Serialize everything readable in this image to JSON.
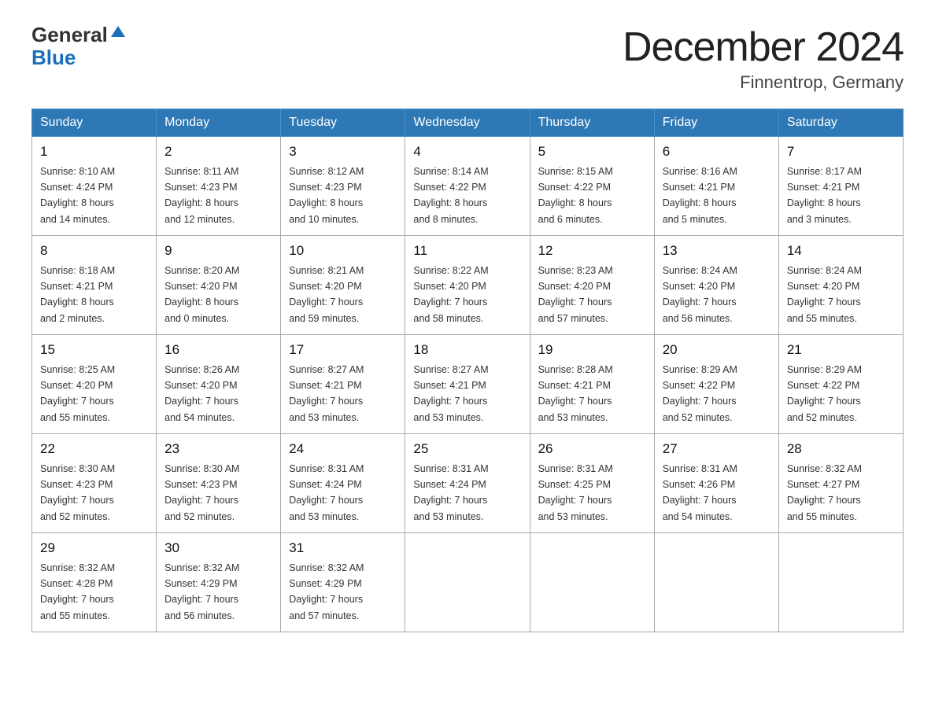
{
  "header": {
    "logo_general": "General",
    "logo_blue": "Blue",
    "month_title": "December 2024",
    "location": "Finnentrop, Germany"
  },
  "weekdays": [
    "Sunday",
    "Monday",
    "Tuesday",
    "Wednesday",
    "Thursday",
    "Friday",
    "Saturday"
  ],
  "weeks": [
    [
      {
        "day": "1",
        "sunrise": "8:10 AM",
        "sunset": "4:24 PM",
        "daylight": "8 hours and 14 minutes."
      },
      {
        "day": "2",
        "sunrise": "8:11 AM",
        "sunset": "4:23 PM",
        "daylight": "8 hours and 12 minutes."
      },
      {
        "day": "3",
        "sunrise": "8:12 AM",
        "sunset": "4:23 PM",
        "daylight": "8 hours and 10 minutes."
      },
      {
        "day": "4",
        "sunrise": "8:14 AM",
        "sunset": "4:22 PM",
        "daylight": "8 hours and 8 minutes."
      },
      {
        "day": "5",
        "sunrise": "8:15 AM",
        "sunset": "4:22 PM",
        "daylight": "8 hours and 6 minutes."
      },
      {
        "day": "6",
        "sunrise": "8:16 AM",
        "sunset": "4:21 PM",
        "daylight": "8 hours and 5 minutes."
      },
      {
        "day": "7",
        "sunrise": "8:17 AM",
        "sunset": "4:21 PM",
        "daylight": "8 hours and 3 minutes."
      }
    ],
    [
      {
        "day": "8",
        "sunrise": "8:18 AM",
        "sunset": "4:21 PM",
        "daylight": "8 hours and 2 minutes."
      },
      {
        "day": "9",
        "sunrise": "8:20 AM",
        "sunset": "4:20 PM",
        "daylight": "8 hours and 0 minutes."
      },
      {
        "day": "10",
        "sunrise": "8:21 AM",
        "sunset": "4:20 PM",
        "daylight": "7 hours and 59 minutes."
      },
      {
        "day": "11",
        "sunrise": "8:22 AM",
        "sunset": "4:20 PM",
        "daylight": "7 hours and 58 minutes."
      },
      {
        "day": "12",
        "sunrise": "8:23 AM",
        "sunset": "4:20 PM",
        "daylight": "7 hours and 57 minutes."
      },
      {
        "day": "13",
        "sunrise": "8:24 AM",
        "sunset": "4:20 PM",
        "daylight": "7 hours and 56 minutes."
      },
      {
        "day": "14",
        "sunrise": "8:24 AM",
        "sunset": "4:20 PM",
        "daylight": "7 hours and 55 minutes."
      }
    ],
    [
      {
        "day": "15",
        "sunrise": "8:25 AM",
        "sunset": "4:20 PM",
        "daylight": "7 hours and 55 minutes."
      },
      {
        "day": "16",
        "sunrise": "8:26 AM",
        "sunset": "4:20 PM",
        "daylight": "7 hours and 54 minutes."
      },
      {
        "day": "17",
        "sunrise": "8:27 AM",
        "sunset": "4:21 PM",
        "daylight": "7 hours and 53 minutes."
      },
      {
        "day": "18",
        "sunrise": "8:27 AM",
        "sunset": "4:21 PM",
        "daylight": "7 hours and 53 minutes."
      },
      {
        "day": "19",
        "sunrise": "8:28 AM",
        "sunset": "4:21 PM",
        "daylight": "7 hours and 53 minutes."
      },
      {
        "day": "20",
        "sunrise": "8:29 AM",
        "sunset": "4:22 PM",
        "daylight": "7 hours and 52 minutes."
      },
      {
        "day": "21",
        "sunrise": "8:29 AM",
        "sunset": "4:22 PM",
        "daylight": "7 hours and 52 minutes."
      }
    ],
    [
      {
        "day": "22",
        "sunrise": "8:30 AM",
        "sunset": "4:23 PM",
        "daylight": "7 hours and 52 minutes."
      },
      {
        "day": "23",
        "sunrise": "8:30 AM",
        "sunset": "4:23 PM",
        "daylight": "7 hours and 52 minutes."
      },
      {
        "day": "24",
        "sunrise": "8:31 AM",
        "sunset": "4:24 PM",
        "daylight": "7 hours and 53 minutes."
      },
      {
        "day": "25",
        "sunrise": "8:31 AM",
        "sunset": "4:24 PM",
        "daylight": "7 hours and 53 minutes."
      },
      {
        "day": "26",
        "sunrise": "8:31 AM",
        "sunset": "4:25 PM",
        "daylight": "7 hours and 53 minutes."
      },
      {
        "day": "27",
        "sunrise": "8:31 AM",
        "sunset": "4:26 PM",
        "daylight": "7 hours and 54 minutes."
      },
      {
        "day": "28",
        "sunrise": "8:32 AM",
        "sunset": "4:27 PM",
        "daylight": "7 hours and 55 minutes."
      }
    ],
    [
      {
        "day": "29",
        "sunrise": "8:32 AM",
        "sunset": "4:28 PM",
        "daylight": "7 hours and 55 minutes."
      },
      {
        "day": "30",
        "sunrise": "8:32 AM",
        "sunset": "4:29 PM",
        "daylight": "7 hours and 56 minutes."
      },
      {
        "day": "31",
        "sunrise": "8:32 AM",
        "sunset": "4:29 PM",
        "daylight": "7 hours and 57 minutes."
      },
      null,
      null,
      null,
      null
    ]
  ],
  "labels": {
    "sunrise": "Sunrise:",
    "sunset": "Sunset:",
    "daylight": "Daylight:"
  }
}
